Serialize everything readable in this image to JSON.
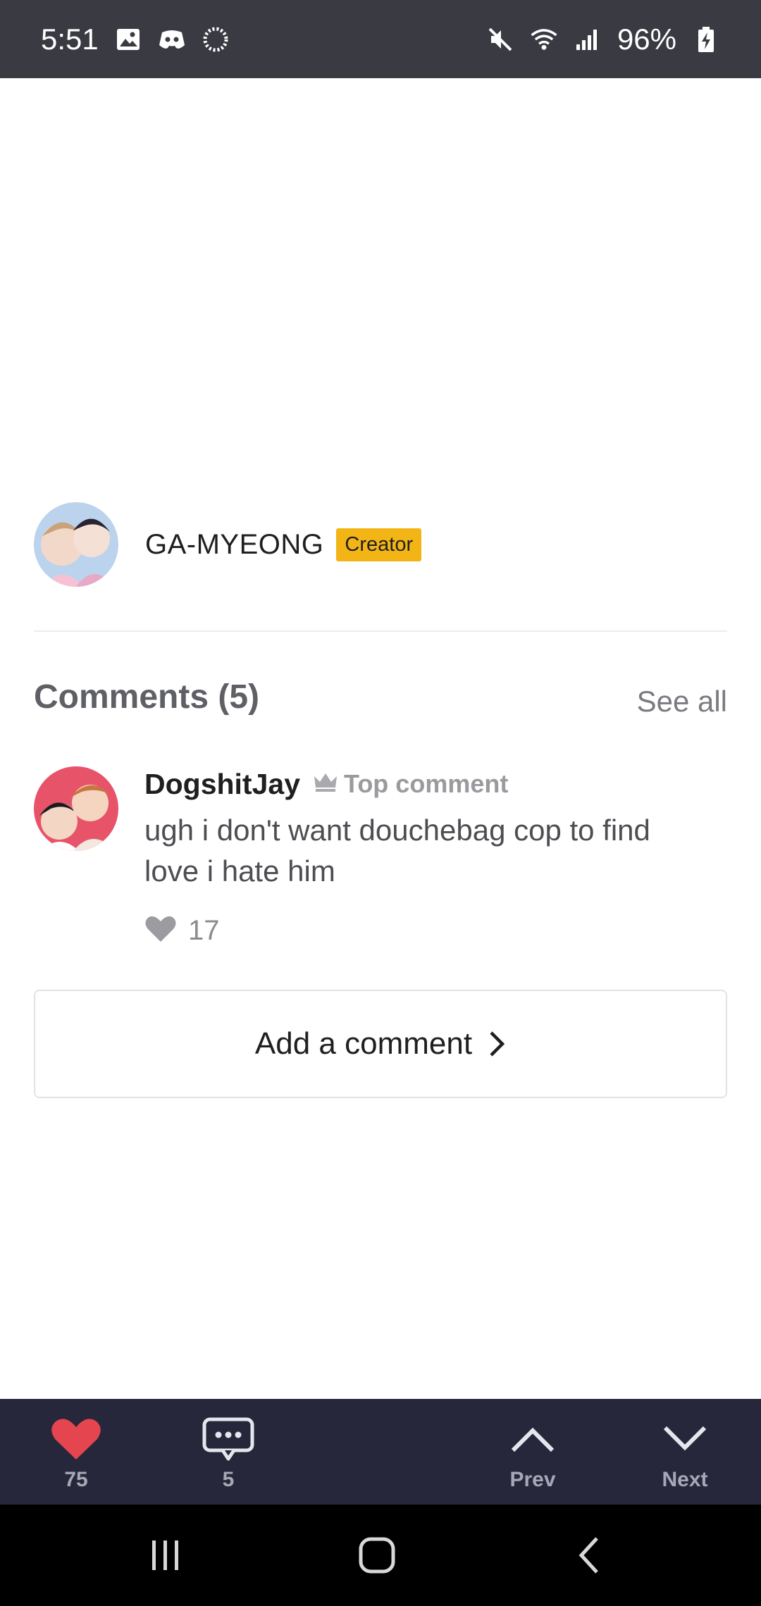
{
  "status_bar": {
    "time": "5:51",
    "battery": "96%",
    "icons_left": [
      "gallery-icon",
      "discord-icon",
      "loading-icon"
    ],
    "icons_right": [
      "mute-icon",
      "wifi-icon",
      "signal-icon",
      "battery-charging-icon"
    ]
  },
  "creator": {
    "name": "GA-MYEONG",
    "badge": "Creator"
  },
  "comments": {
    "title": "Comments (5)",
    "see_all": "See all",
    "top": {
      "author": "DogshitJay",
      "label": "Top comment",
      "text": "ugh i don't want douchebag cop to find love i hate him",
      "likes": "17"
    },
    "add_label": "Add a comment"
  },
  "action_bar": {
    "likes": "75",
    "comments": "5",
    "prev": "Prev",
    "next": "Next"
  },
  "colors": {
    "status_bar": "#393a42",
    "action_bar": "#26273a",
    "heart": "#e5454f",
    "badge": "#f3b516"
  }
}
